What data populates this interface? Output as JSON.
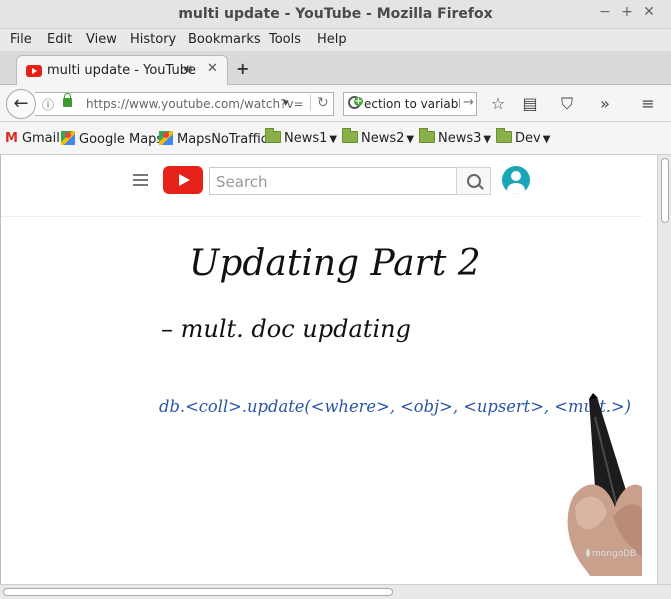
{
  "window": {
    "title": "multi update - YouTube - Mozilla Firefox",
    "controls": [
      "−",
      "+",
      "✕"
    ]
  },
  "menubar": [
    "File",
    "Edit",
    "View",
    "History",
    "Bookmarks",
    "Tools",
    "Help"
  ],
  "tab": {
    "title": "multi update - YouTube",
    "audio_icon": "speaker-icon",
    "close": "✕",
    "new_tab": "+"
  },
  "navbar": {
    "back": "←",
    "info": "ⓘ",
    "url": "https://www.youtube.com/watch?v=",
    "dropdown": "▾",
    "reload": "↻",
    "search_text": "ection to variable",
    "search_go": "→",
    "icons": [
      "star-icon",
      "reading-list-icon",
      "pocket-icon",
      "overflow-icon",
      "menu-icon"
    ],
    "glyphs": [
      "☆",
      "▤",
      "⛉",
      "»",
      "≡"
    ]
  },
  "bookmarks": [
    {
      "label": "Gmail",
      "icon": "gmail-icon"
    },
    {
      "label": "Google Maps",
      "icon": "maps-icon"
    },
    {
      "label": "MapsNoTraffic",
      "icon": "maps-icon"
    },
    {
      "label": "News1",
      "icon": "folder-icon"
    },
    {
      "label": "News2",
      "icon": "folder-icon"
    },
    {
      "label": "News3",
      "icon": "folder-icon"
    },
    {
      "label": "Dev",
      "icon": "folder-icon"
    }
  ],
  "youtube": {
    "search_placeholder": "Search"
  },
  "video": {
    "heading": "Updating  Part 2",
    "bullet": "– mult. doc updating",
    "code": "db.<coll>.update(<where>, <obj>, <upsert>, <mult.>)",
    "watermark": "mongoDB",
    "ink_dark": "#111111",
    "ink_blue": "#2b55a6"
  },
  "colors": {
    "youtube_red": "#e62117",
    "avatar": "#1aa6b7"
  }
}
